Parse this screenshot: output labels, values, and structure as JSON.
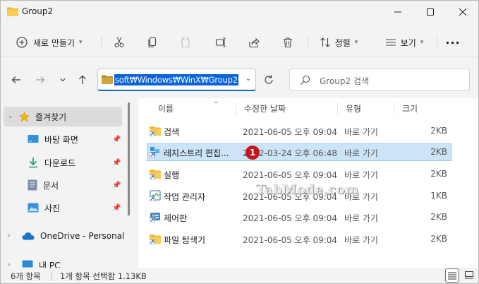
{
  "window": {
    "title": "Group2"
  },
  "toolbar": {
    "new_label": "새로 만들기",
    "sort_label": "정렬",
    "view_label": "보기",
    "more_label": "···"
  },
  "address": {
    "path": "soft₩Windows₩WinX₩Group2",
    "search_placeholder": "Group2 검색"
  },
  "sidebar": {
    "quick_access": "즐겨찾기",
    "items": [
      {
        "label": "바탕 화면",
        "icon": "desktop-icon",
        "pinned": true
      },
      {
        "label": "다운로드",
        "icon": "download-icon",
        "pinned": true
      },
      {
        "label": "문서",
        "icon": "document-icon",
        "pinned": true
      },
      {
        "label": "사진",
        "icon": "picture-icon",
        "pinned": true
      }
    ],
    "onedrive": "OneDrive - Personal",
    "this_pc": "내 PC"
  },
  "columns": {
    "name": "이름",
    "date": "수정한 날짜",
    "type": "유형",
    "size": "크기"
  },
  "files": [
    {
      "name": "검색",
      "date": "2021-06-05 오후 09:04",
      "type": "바로 가기",
      "size": "2KB",
      "icon": "folder-shortcut-icon"
    },
    {
      "name": "레지스트리 편집...",
      "date": "2022-03-24 오후 06:48",
      "type": "바로 가기",
      "size": "2KB",
      "icon": "registry-editor-icon",
      "selected": true
    },
    {
      "name": "실행",
      "date": "2021-06-05 오후 09:04",
      "type": "바로 가기",
      "size": "2KB",
      "icon": "folder-shortcut-icon"
    },
    {
      "name": "작업 관리자",
      "date": "2021-06-05 오후 09:04",
      "type": "바로 가기",
      "size": "1KB",
      "icon": "task-manager-icon"
    },
    {
      "name": "제어판",
      "date": "2021-06-05 오후 09:04",
      "type": "바로 가기",
      "size": "2KB",
      "icon": "control-panel-icon"
    },
    {
      "name": "파일 탐색기",
      "date": "2021-06-05 오후 09:04",
      "type": "바로 가기",
      "size": "2KB",
      "icon": "folder-shortcut-icon"
    }
  ],
  "annotation": {
    "badge": "1"
  },
  "watermark": "TabMode.com",
  "status": {
    "item_count": "6개 항목",
    "selection": "1개 항목 선택함 1.13KB"
  },
  "colors": {
    "accent": "#0067c0",
    "selection": "#cce4f7",
    "folder": "#f4c542",
    "badge": "#c4161c"
  }
}
